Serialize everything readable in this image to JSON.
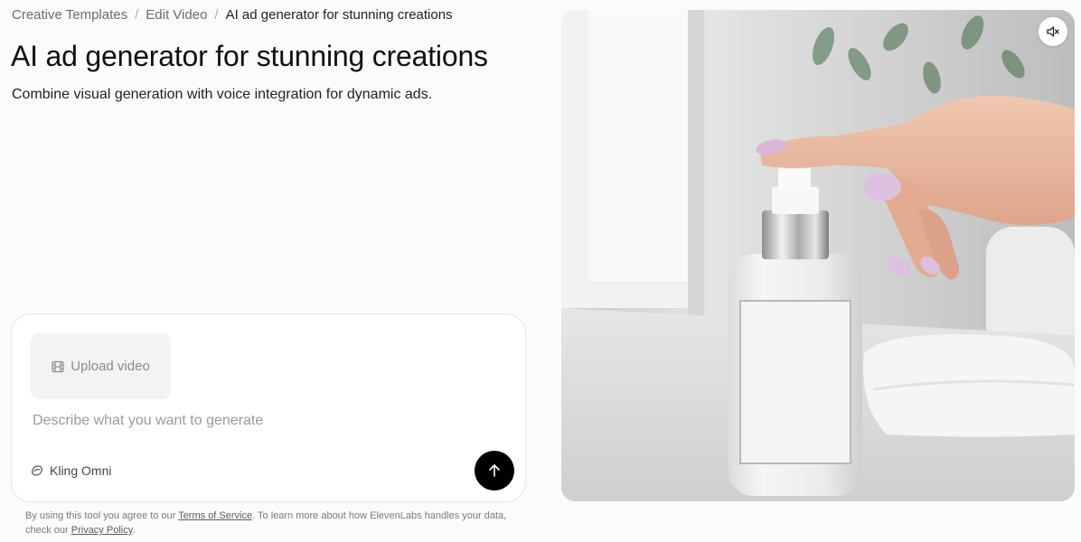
{
  "breadcrumb": {
    "items": [
      "Creative Templates",
      "Edit Video",
      "AI ad generator for stunning creations"
    ],
    "separator": "/"
  },
  "page": {
    "title": "AI ad generator for stunning creations",
    "subtitle": "Combine visual generation with voice integration for dynamic ads."
  },
  "prompt": {
    "upload_label": "Upload video",
    "upload_icon": "film-icon",
    "placeholder": "Describe what you want to generate",
    "value": "",
    "model_label": "Kling Omni",
    "model_icon": "kling-logo-icon",
    "send_icon": "arrow-up-icon"
  },
  "disclaimer": {
    "prefix": "By using this tool you agree to our ",
    "terms_link": "Terms of Service",
    "middle": ". To learn more about how ElevenLabs handles your data, check our ",
    "privacy_link": "Privacy Policy",
    "suffix": "."
  },
  "preview": {
    "mute_icon": "speaker-muted-icon"
  },
  "colors": {
    "background": "#fbfbfb",
    "send_button": "#000000",
    "upload_button": "#f3f3f3",
    "text_muted": "#6b6b6b"
  }
}
